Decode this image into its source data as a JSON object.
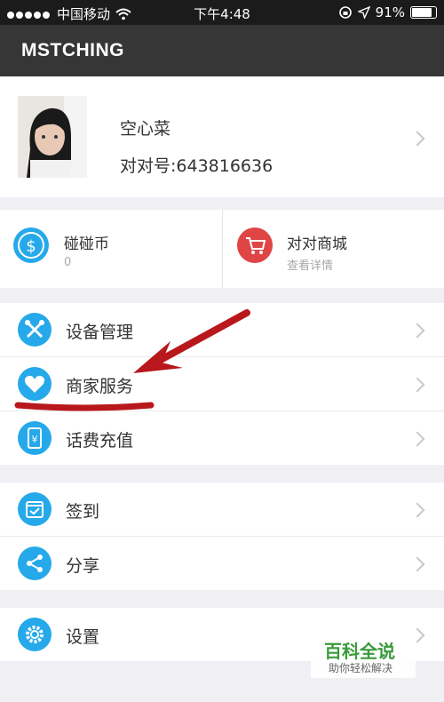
{
  "status_bar": {
    "carrier": "中国移动",
    "time": "下午4:48",
    "battery": "91%",
    "battery_level": 0.91
  },
  "header": {
    "title": "MSTCHING"
  },
  "profile": {
    "name": "空心菜",
    "id_line": "对对号:643816636"
  },
  "cards": [
    {
      "title": "碰碰币",
      "subtitle": "0",
      "icon": "dollar-icon",
      "color": "#25a9ea"
    },
    {
      "title": "对对商城",
      "subtitle": "查看详情",
      "icon": "shopping-cart-icon",
      "color": "#e04545"
    }
  ],
  "menu_group_1": [
    {
      "label": "设备管理",
      "icon": "tools-icon"
    },
    {
      "label": "商家服务",
      "icon": "heart-icon"
    },
    {
      "label": "话费充值",
      "icon": "phone-yuan-icon"
    }
  ],
  "menu_group_2": [
    {
      "label": "签到",
      "icon": "calendar-check-icon"
    },
    {
      "label": "分享",
      "icon": "share-icon"
    }
  ],
  "menu_group_3": [
    {
      "label": "设置",
      "icon": "gear-icon"
    }
  ],
  "watermark": {
    "title": "百科全说",
    "subtitle": "助你轻松解决"
  },
  "colors": {
    "accent": "#25a9ea",
    "header": "#363636",
    "annotation": "#b8171c"
  }
}
